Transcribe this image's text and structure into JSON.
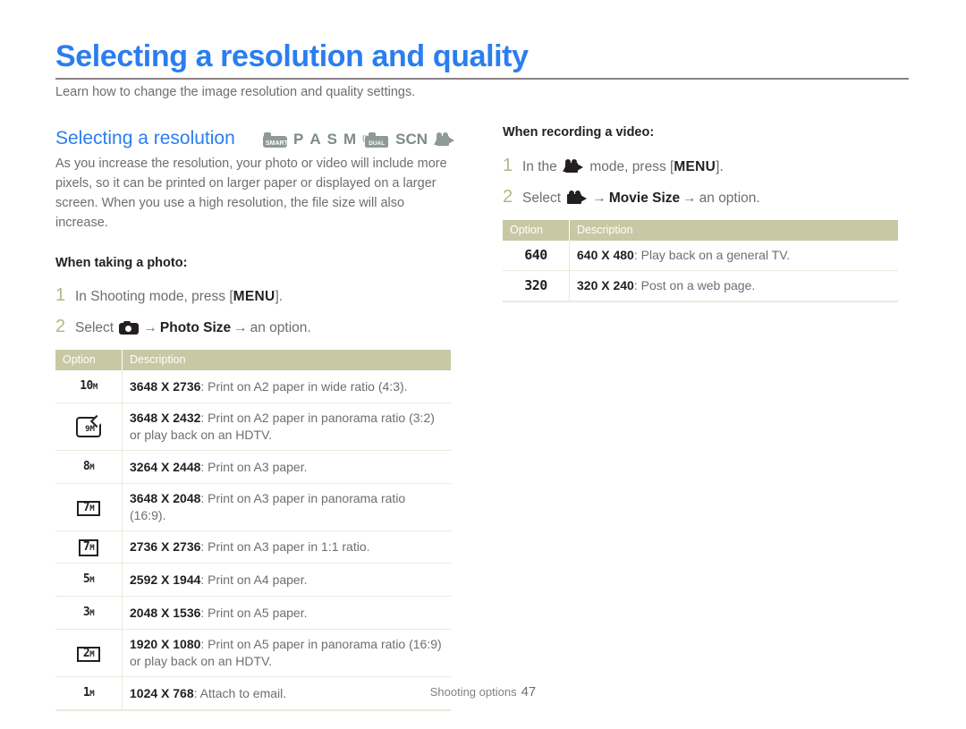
{
  "document": {
    "title": "Selecting a resolution and quality",
    "intro": "Learn how to change the image resolution and quality settings.",
    "title_color": "#2a7ef0",
    "rule_color": "#8b8284"
  },
  "section": {
    "heading": "Selecting a resolution",
    "mode_icons": [
      {
        "name": "smart-mode-icon",
        "label": "SMART"
      },
      {
        "name": "p-mode-icon",
        "label": "P"
      },
      {
        "name": "a-mode-icon",
        "label": "A"
      },
      {
        "name": "s-mode-icon",
        "label": "S"
      },
      {
        "name": "m-mode-icon",
        "label": "M"
      },
      {
        "name": "dual-is-mode-icon",
        "label": "DUAL"
      },
      {
        "name": "scn-mode-icon",
        "label": "SCN"
      },
      {
        "name": "movie-mode-icon",
        "label": "movie"
      }
    ],
    "paragraph": "As you increase the resolution, your photo or video will include more pixels, so it can be printed on larger paper or displayed on a larger screen. When you use a high resolution, the file size will also increase."
  },
  "photo": {
    "subhead": "When taking a photo:",
    "steps": [
      {
        "num": "1",
        "pre": "In Shooting mode, press [",
        "key": "MENU",
        "post": "]."
      },
      {
        "num": "2",
        "pre": "Select ",
        "icon": "photo-camera-icon",
        "mid": "Photo Size",
        "post": "an option."
      }
    ],
    "table": {
      "columns": [
        "Option",
        "Description"
      ],
      "rows": [
        {
          "option": "10M",
          "option_kind": "plain",
          "res": "3648 X 2736",
          "desc": ": Print on A2 paper in wide ratio (4:3)."
        },
        {
          "option": "9M",
          "option_kind": "card",
          "res": "3648 X 2432",
          "desc": ": Print on A2 paper in panorama ratio (3:2) or play back on an HDTV."
        },
        {
          "option": "8M",
          "option_kind": "plain",
          "res": "3264 X 2448",
          "desc": ": Print on A3 paper."
        },
        {
          "option": "7M",
          "option_kind": "boxed-wide",
          "res": "3648 X 2048",
          "desc": ": Print on A3 paper in panorama ratio (16:9)."
        },
        {
          "option": "7M",
          "option_kind": "boxed",
          "res": "2736 X 2736",
          "desc": ": Print on A3 paper in 1:1 ratio."
        },
        {
          "option": "5M",
          "option_kind": "plain",
          "res": "2592 X 1944",
          "desc": ": Print on A4 paper."
        },
        {
          "option": "3M",
          "option_kind": "plain",
          "res": "2048 X 1536",
          "desc": ": Print on A5 paper."
        },
        {
          "option": "2M",
          "option_kind": "boxed-wide",
          "res": "1920 X 1080",
          "desc": ": Print on A5 paper in panorama ratio (16:9) or play back on an HDTV."
        },
        {
          "option": "1M",
          "option_kind": "plain",
          "res": "1024 X 768",
          "desc": ": Attach to email."
        }
      ]
    }
  },
  "video": {
    "subhead": "When recording a video:",
    "steps": [
      {
        "num": "1",
        "pre": "In the ",
        "icon": "movie-mode-icon",
        "mid_pre": " mode, press [",
        "key": "MENU",
        "post": "]."
      },
      {
        "num": "2",
        "pre": "Select ",
        "icon": "movie-camera-icon",
        "mid": "Movie Size",
        "post": "an option."
      }
    ],
    "table": {
      "columns": [
        "Option",
        "Description"
      ],
      "rows": [
        {
          "option": "640",
          "option_kind": "lcd",
          "res": "640 X 480",
          "desc": ": Play back on a general TV."
        },
        {
          "option": "320",
          "option_kind": "lcd",
          "res": "320 X 240",
          "desc": ": Post on a web page."
        }
      ]
    }
  },
  "footer": {
    "label": "Shooting options",
    "page": "47"
  },
  "arrow_glyph": "→"
}
